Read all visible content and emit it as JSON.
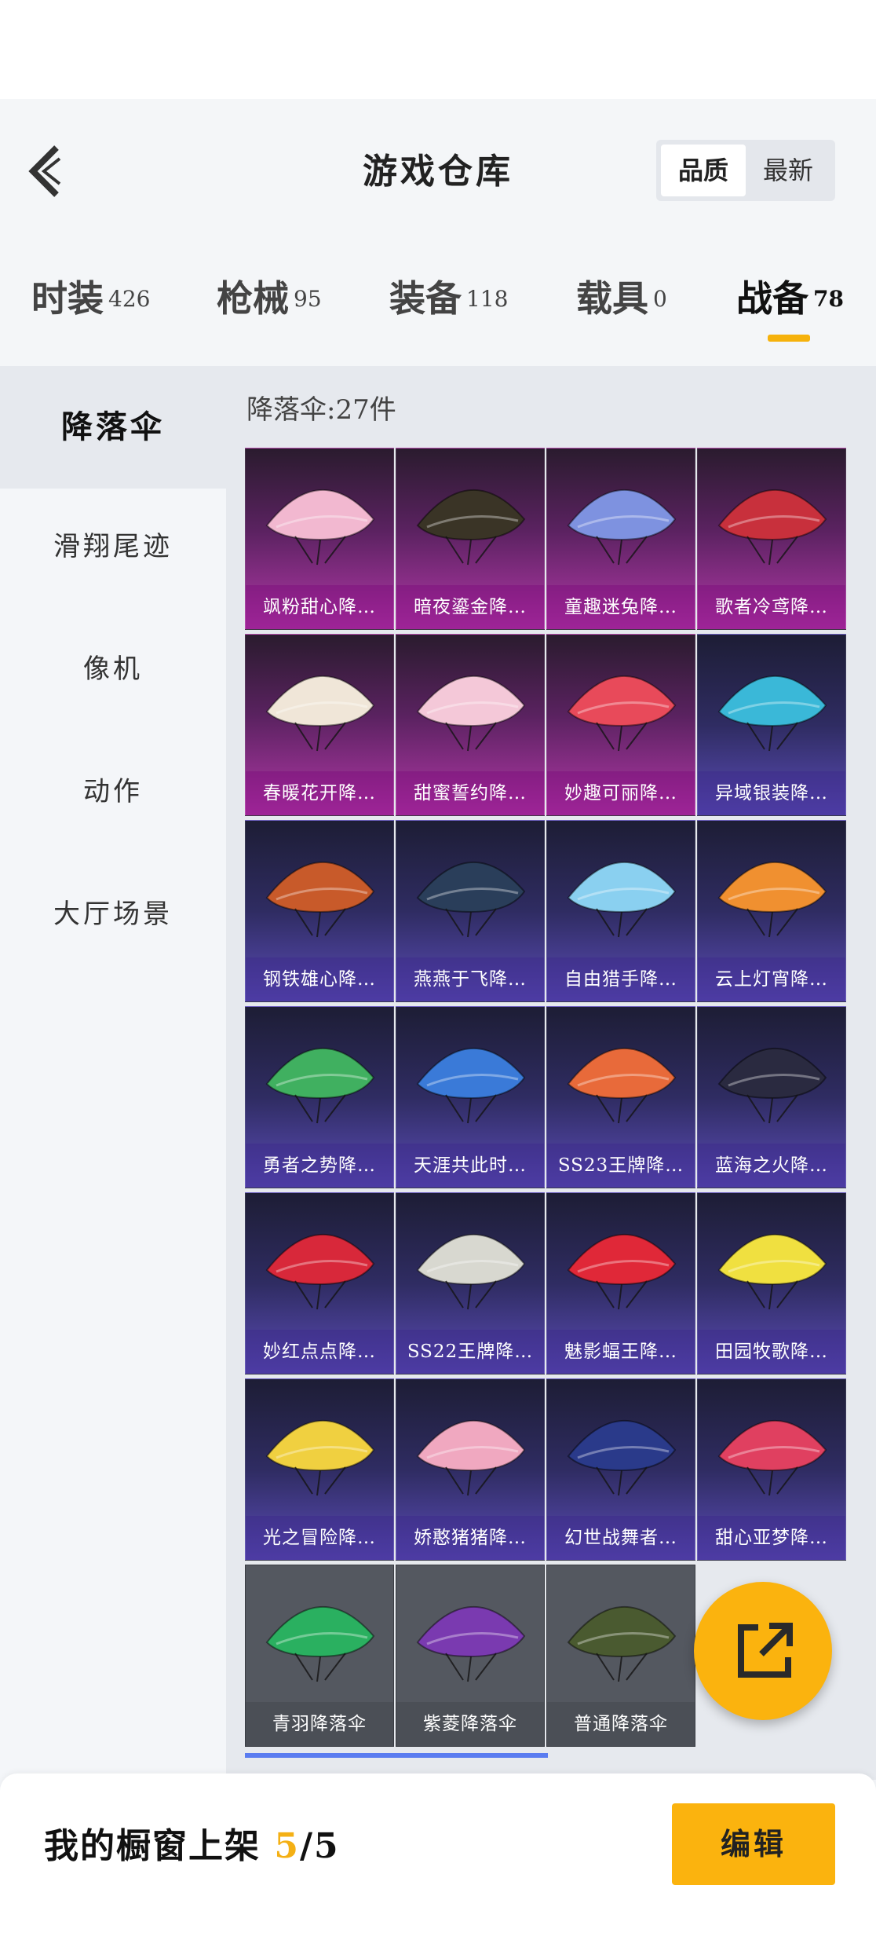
{
  "header": {
    "title": "游戏仓库",
    "sort_options": [
      "品质",
      "最新"
    ],
    "sort_selected": "品质"
  },
  "tabs": [
    {
      "label": "时装",
      "count": "426"
    },
    {
      "label": "枪械",
      "count": "95"
    },
    {
      "label": "装备",
      "count": "118"
    },
    {
      "label": "载具",
      "count": "0"
    },
    {
      "label": "战备",
      "count": "78",
      "active": true
    }
  ],
  "sidebar": {
    "items": [
      "降落伞",
      "滑翔尾迹",
      "像机",
      "动作",
      "大厅场景"
    ],
    "active": "降落伞"
  },
  "main": {
    "count_text": "降落伞:27件",
    "items": [
      {
        "name": "飒粉甜心降…",
        "rarity": "legend"
      },
      {
        "name": "暗夜鎏金降…",
        "rarity": "legend"
      },
      {
        "name": "童趣迷兔降…",
        "rarity": "legend"
      },
      {
        "name": "歌者冷鸢降…",
        "rarity": "legend"
      },
      {
        "name": "春暖花开降…",
        "rarity": "legend"
      },
      {
        "name": "甜蜜誓约降…",
        "rarity": "legend"
      },
      {
        "name": "妙趣可丽降…",
        "rarity": "legend"
      },
      {
        "name": "异域银装降…",
        "rarity": "epic"
      },
      {
        "name": "钢铁雄心降…",
        "rarity": "epic"
      },
      {
        "name": "燕燕于飞降…",
        "rarity": "epic"
      },
      {
        "name": "自由猎手降…",
        "rarity": "epic"
      },
      {
        "name": "云上灯宵降…",
        "rarity": "epic"
      },
      {
        "name": "勇者之势降…",
        "rarity": "epic"
      },
      {
        "name": "天涯共此时…",
        "rarity": "epic"
      },
      {
        "name": "SS23王牌降…",
        "rarity": "epic"
      },
      {
        "name": "蓝海之火降…",
        "rarity": "epic"
      },
      {
        "name": "妙红点点降…",
        "rarity": "epic"
      },
      {
        "name": "SS22王牌降…",
        "rarity": "epic"
      },
      {
        "name": "魅影蝠王降…",
        "rarity": "epic"
      },
      {
        "name": "田园牧歌降…",
        "rarity": "epic"
      },
      {
        "name": "光之冒险降…",
        "rarity": "epic"
      },
      {
        "name": "娇憨猪猪降…",
        "rarity": "epic"
      },
      {
        "name": "幻世战舞者…",
        "rarity": "epic"
      },
      {
        "name": "甜心亚梦降…",
        "rarity": "epic"
      },
      {
        "name": "青羽降落伞",
        "rarity": "common"
      },
      {
        "name": "紫菱降落伞",
        "rarity": "common"
      },
      {
        "name": "普通降落伞",
        "rarity": "common"
      }
    ]
  },
  "colors": {
    "accent": "#fbb30e",
    "legend": "#b338a8",
    "epic": "#5b4cb8",
    "common": "#545860",
    "canopies": [
      "#f2b8d0",
      "#3a3426",
      "#7e92e0",
      "#c8303c",
      "#f0e6d8",
      "#f4c8d8",
      "#e84a5a",
      "#3ab8d8",
      "#c85a2a",
      "#2a3e5a",
      "#8ad0f0",
      "#f09030",
      "#40b060",
      "#3a7ad8",
      "#e86a3a",
      "#2a2a40",
      "#d8283a",
      "#d8d8d0",
      "#e02838",
      "#f0e040",
      "#f0d040",
      "#f0a8c0",
      "#2a3a8a",
      "#e04060",
      "#2ab060",
      "#7a3ab0",
      "#4a5a30"
    ]
  },
  "bottom_bar": {
    "label": "我的橱窗上架",
    "count": "5",
    "total": "/5",
    "edit_label": "编辑"
  }
}
